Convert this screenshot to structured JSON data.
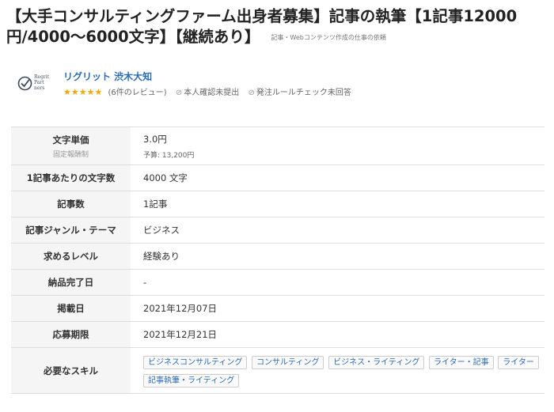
{
  "job": {
    "title": "【大手コンサルティングファーム出身者募集】記事の執筆【1記事12000円/4000〜6000文字】【継続あり】",
    "category": "記事・Webコンテンツ作成の仕事の依頼"
  },
  "client": {
    "logo_text": "Regrit Part ners",
    "name": "リグリット 渋木大知",
    "stars": "★★★★★",
    "rating": 5,
    "reviews": "(6件のレビュー)",
    "identity_status": "本人確認未提出",
    "rule_check_status": "発注ルールチェック未回答",
    "icons": [
      "check-circle-icon",
      "star-icon",
      "check-circle-small-icon"
    ],
    "colors": {
      "name": "#2a6bb7",
      "stars": "#f2a900"
    }
  },
  "details": {
    "unit_price_label": "文字単価",
    "unit_price_type": "固定報酬制",
    "unit_price_value": "3.0円",
    "budget": "予算: 13,200円",
    "chars_label": "1記事あたりの文字数",
    "chars_value": "4000 文字",
    "count_label": "記事数",
    "count_value": "1記事",
    "genre_label": "記事ジャンル・テーマ",
    "genre_value": "ビジネス",
    "level_label": "求めるレベル",
    "level_value": "経験あり",
    "delivery_label": "納品完了日",
    "delivery_value": "-",
    "posted_label": "掲載日",
    "posted_value": "2021年12月07日",
    "deadline_label": "応募期限",
    "deadline_value": "2021年12月21日",
    "skills_label": "必要なスキル",
    "skills": [
      "ビジネスコンサルティング",
      "コンサルティング",
      "ビジネス・ライティング",
      "ライター・記事",
      "ライター",
      "記事執筆・ライティング"
    ]
  }
}
